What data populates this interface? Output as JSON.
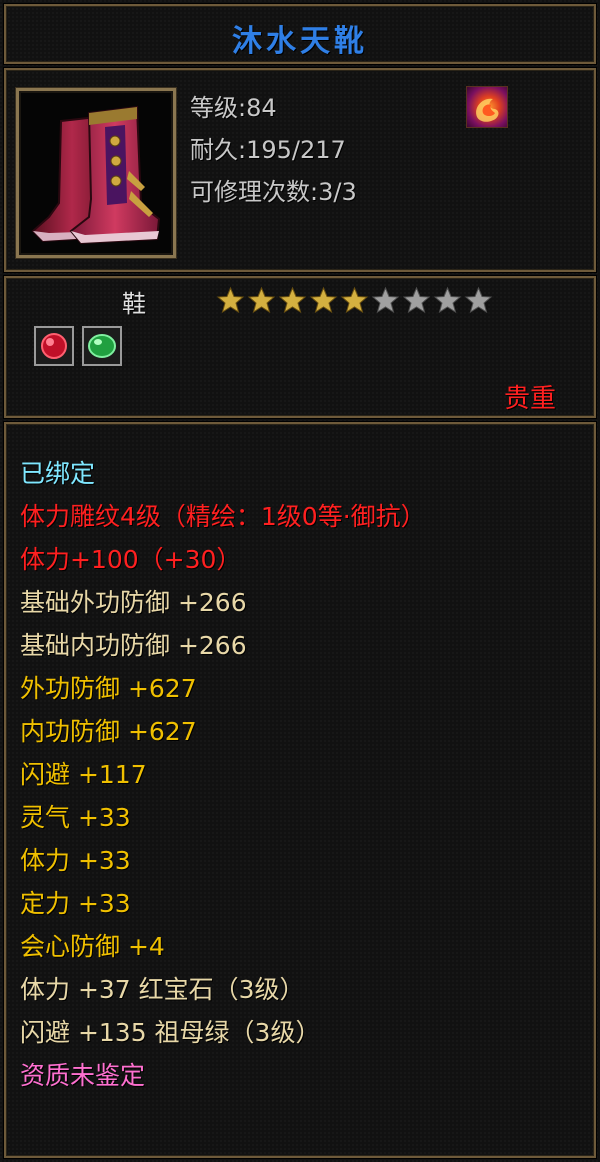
{
  "title": "沐水天靴",
  "item": {
    "level_text": "等级:84",
    "durability_text": "耐久:195/217",
    "repair_text": "可修理次数:3/3",
    "skill_icon": "flame-swirl-icon",
    "image_icon": "boots-icon"
  },
  "type": {
    "label": "鞋",
    "stars_filled": 5,
    "stars_total": 9,
    "gems": [
      "red-gem-icon",
      "green-gem-icon"
    ],
    "rarity": "贵重"
  },
  "colors": {
    "title": "#2f7fe6",
    "bound": "#7fe7ff",
    "red": "#ff2020",
    "base": "#e8d8a8",
    "gold": "#f0c000",
    "purple": "#ff70d0",
    "star_filled": "#d4b040",
    "star_empty": "#a0a0a0"
  },
  "attributes": [
    {
      "text": "已绑定",
      "color": "#7fe7ff"
    },
    {
      "text": "体力雕纹4级（精绘：1级0等·御抗）",
      "color": "#ff2020"
    },
    {
      "text": "体力+100（+30）",
      "color": "#ff2020"
    },
    {
      "text": "基础外功防御 +266",
      "color": "#e8d8a8"
    },
    {
      "text": "基础内功防御 +266",
      "color": "#e8d8a8"
    },
    {
      "text": "外功防御 +627",
      "color": "#f0c000"
    },
    {
      "text": "内功防御 +627",
      "color": "#f0c000"
    },
    {
      "text": "闪避 +117",
      "color": "#f0c000"
    },
    {
      "text": "灵气 +33",
      "color": "#f0c000"
    },
    {
      "text": "体力 +33",
      "color": "#f0c000"
    },
    {
      "text": "定力 +33",
      "color": "#f0c000"
    },
    {
      "text": "会心防御 +4",
      "color": "#f0c000"
    },
    {
      "text": "体力 +37 红宝石（3级）",
      "color": "#e8d8a8"
    },
    {
      "text": "闪避 +135 祖母绿（3级）",
      "color": "#e8d8a8"
    },
    {
      "text": "资质未鉴定",
      "color": "#ff70d0"
    }
  ]
}
